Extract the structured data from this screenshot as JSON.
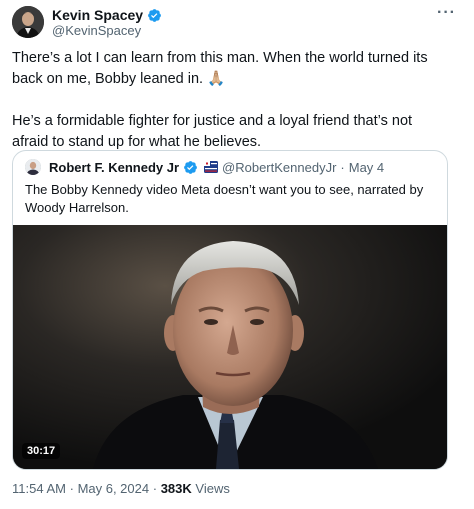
{
  "author": {
    "name": "Kevin Spacey",
    "handle": "@KevinSpacey",
    "verified": true
  },
  "menu_glyph": "···",
  "tweet": {
    "paragraph1": "There’s a lot I can learn from this man. When the world turned its back on me, Bobby leaned in. 🙏🏼",
    "paragraph2": "He’s a formidable fighter for justice and a loyal friend that’s not afraid to stand up for what he believes."
  },
  "quoted": {
    "name": "Robert F. Kennedy Jr",
    "handle": "@RobertKennedyJr",
    "separator": "·",
    "date": "May 4",
    "text": "The Bobby Kennedy video Meta doesn’t want you to see, narrated by Woody Harrelson.",
    "video_duration": "30:17"
  },
  "footer": {
    "time": "11:54 AM",
    "separator": "·",
    "date": "May 6, 2024",
    "separator2": "·",
    "views_count": "383K",
    "views_label": "Views"
  },
  "colors": {
    "verified": "#1d9bf0",
    "secondary_text": "#536471",
    "border": "#cfd9de"
  },
  "icons": [
    "verified-badge-icon",
    "more-options-icon",
    "flag-icon"
  ]
}
